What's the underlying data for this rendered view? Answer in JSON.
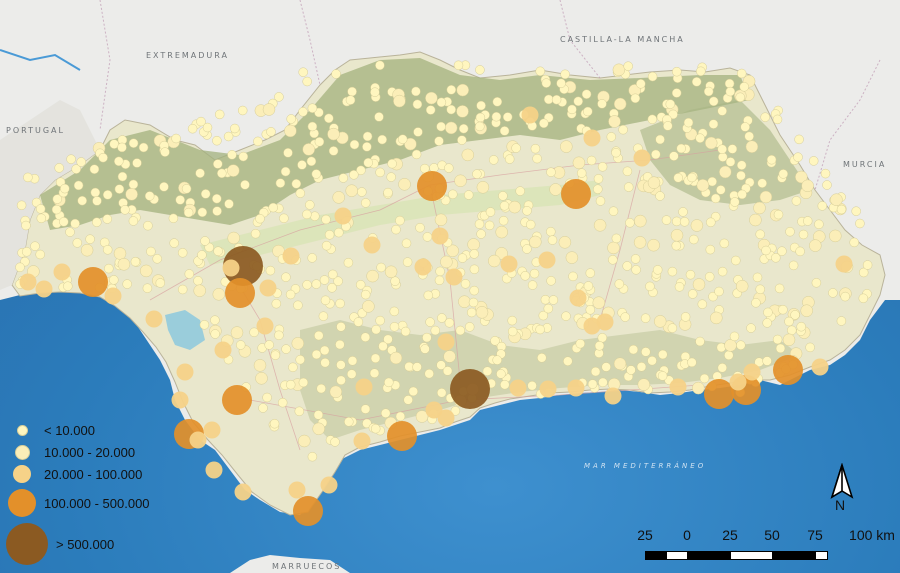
{
  "map": {
    "regions": [
      {
        "id": "extremadura",
        "label": "EXTREMADURA"
      },
      {
        "id": "castilla",
        "label": "CASTILLA-LA MANCHA"
      },
      {
        "id": "portugal",
        "label": "PORTUGAL"
      },
      {
        "id": "murcia",
        "label": "MURCIA"
      },
      {
        "id": "marruecos",
        "label": "MARRUECOS"
      },
      {
        "id": "sea",
        "label": "MAR MEDITERRÁNEO"
      }
    ],
    "colors": {
      "sea": "#2a79b8",
      "land_outside": "#ededeb",
      "andalusia_land": "#e9e6c9",
      "forest": "#9fb07c",
      "class_small": "#fff6bf",
      "class_medium": "#fbe6a8",
      "class_large": "#f6cc7a",
      "class_city": "#e3902a",
      "class_capital": "#8b5a22"
    }
  },
  "legend": {
    "items": [
      {
        "label": "< 10.000",
        "color": "#fff6bf"
      },
      {
        "label": "10.000 - 20.000",
        "color": "#fbeeb8"
      },
      {
        "label": "20.000 - 100.000",
        "color": "#f6d288"
      },
      {
        "label": "100.000 - 500.000",
        "color": "#e3902a"
      },
      {
        "label": "> 500.000",
        "color": "#8b5a22"
      }
    ]
  },
  "north_arrow": {
    "label": "N"
  },
  "scalebar": {
    "labels": [
      "25",
      "0",
      "25",
      "50",
      "75",
      "100 km"
    ]
  }
}
